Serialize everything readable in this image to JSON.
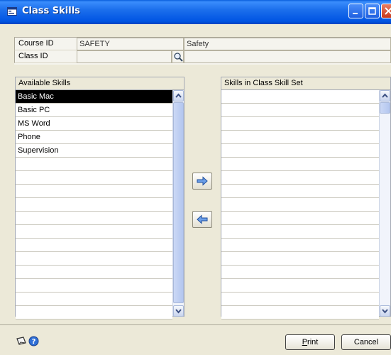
{
  "window": {
    "title": "Class Skills"
  },
  "fields": {
    "course_id_label": "Course ID",
    "course_id_value": "SAFETY",
    "course_desc": "Safety",
    "class_id_label": "Class ID",
    "class_id_value": ""
  },
  "available": {
    "header": "Available Skills",
    "items": [
      "Basic Mac",
      "Basic PC",
      "MS Word",
      "Phone",
      "Supervision"
    ],
    "selected": "Basic Mac"
  },
  "assigned": {
    "header": "Skills in Class Skill Set",
    "items": []
  },
  "buttons": {
    "print_u": "P",
    "print_rest": "rint",
    "cancel": "Cancel"
  },
  "colors": {
    "title_bar": "#0054e3",
    "dialog_bg": "#ece9d8",
    "selection": "#000000"
  },
  "icons": [
    "window-icon",
    "minimize-icon",
    "maximize-icon",
    "close-icon",
    "lookup-icon",
    "move-right-icon",
    "move-left-icon",
    "note-icon",
    "help-icon"
  ]
}
